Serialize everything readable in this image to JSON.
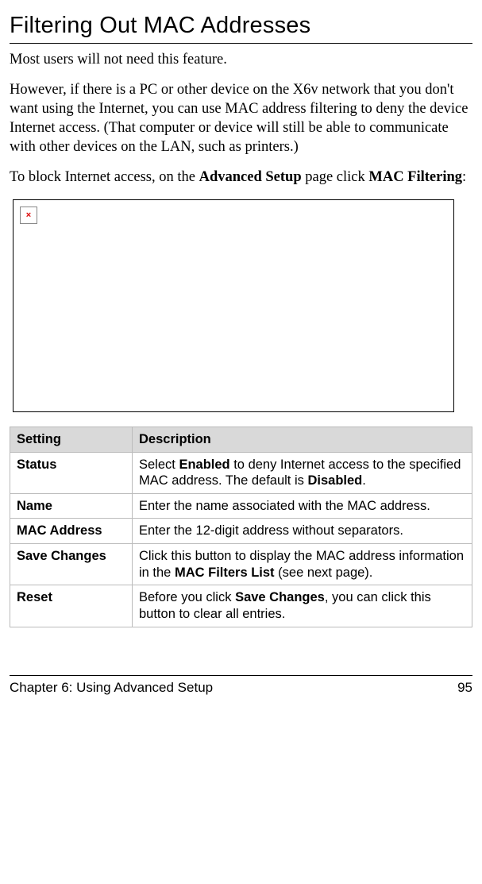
{
  "title": "Filtering Out MAC Addresses",
  "paragraphs": {
    "p1": "Most users will not need this feature.",
    "p2": "However, if there is a PC or other device on the X6v network that you don't want using the Internet, you can use MAC address filtering to deny the device Internet access. (That computer or device will still be able to communicate with other devices on the LAN, such as printers.)",
    "p3_pre": "To block Internet access, on the ",
    "p3_b1": "Advanced Setup",
    "p3_mid": " page click ",
    "p3_b2": "MAC Filtering",
    "p3_post": ":"
  },
  "table": {
    "head_setting": "Setting",
    "head_description": "Description",
    "rows": [
      {
        "setting": "Status",
        "d_pre": "Select ",
        "d_b1": "Enabled",
        "d_mid": " to deny Internet access to the specified MAC address. The default is ",
        "d_b2": "Disabled",
        "d_post": "."
      },
      {
        "setting": "Name",
        "d_pre": "Enter the name associated with the MAC address.",
        "d_b1": "",
        "d_mid": "",
        "d_b2": "",
        "d_post": ""
      },
      {
        "setting": "MAC Address",
        "d_pre": "Enter the 12-digit address without separators.",
        "d_b1": "",
        "d_mid": "",
        "d_b2": "",
        "d_post": ""
      },
      {
        "setting": "Save Changes",
        "d_pre": "Click this button to display the MAC address information in the ",
        "d_b1": "MAC Filters List",
        "d_mid": " (see next page).",
        "d_b2": "",
        "d_post": ""
      },
      {
        "setting": "Reset",
        "d_pre": "Before you click ",
        "d_b1": "Save Changes",
        "d_mid": ", you can click this button to clear all entries.",
        "d_b2": "",
        "d_post": ""
      }
    ]
  },
  "footer": {
    "chapter": "Chapter 6: Using Advanced Setup",
    "page": "95"
  },
  "broken_icon_glyph": "×"
}
